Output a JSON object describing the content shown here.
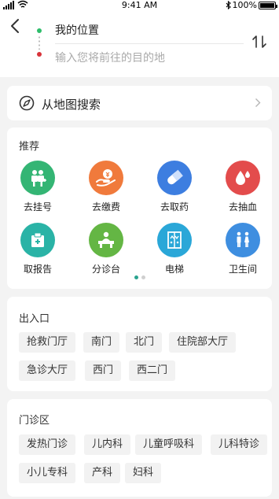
{
  "status": {
    "time": "9:41 AM",
    "battery": "100%"
  },
  "header": {
    "from": "我的位置",
    "to_placeholder": "输入您将前往的目的地"
  },
  "map_search": {
    "label": "从地图搜索"
  },
  "recommend": {
    "title": "推荐",
    "items": [
      {
        "label": "去挂号",
        "icon": "registration-icon",
        "color": "#34b574"
      },
      {
        "label": "去缴费",
        "icon": "payment-icon",
        "color": "#f07a3c"
      },
      {
        "label": "去取药",
        "icon": "pill-icon",
        "color": "#3d7ee0"
      },
      {
        "label": "去抽血",
        "icon": "blood-drop-icon",
        "color": "#e34c4c"
      },
      {
        "label": "取报告",
        "icon": "report-icon",
        "color": "#2ab3a6"
      },
      {
        "label": "分诊台",
        "icon": "triage-desk-icon",
        "color": "#64b644"
      },
      {
        "label": "电梯",
        "icon": "elevator-icon",
        "color": "#2aa7d8"
      },
      {
        "label": "卫生间",
        "icon": "restroom-icon",
        "color": "#3e8ee0"
      }
    ],
    "page_count": 2,
    "active_page": 1
  },
  "entrance": {
    "title": "出入口",
    "chips": [
      "抢救门厅",
      "南门",
      "北门",
      "住院部大厅",
      "急诊大厅",
      "西门",
      "西二门"
    ]
  },
  "clinic": {
    "title": "门诊区",
    "chips": [
      "发热门诊",
      "儿内科",
      "儿童呼吸科",
      "儿科特诊",
      "小儿专科",
      "产科",
      "妇科"
    ]
  }
}
